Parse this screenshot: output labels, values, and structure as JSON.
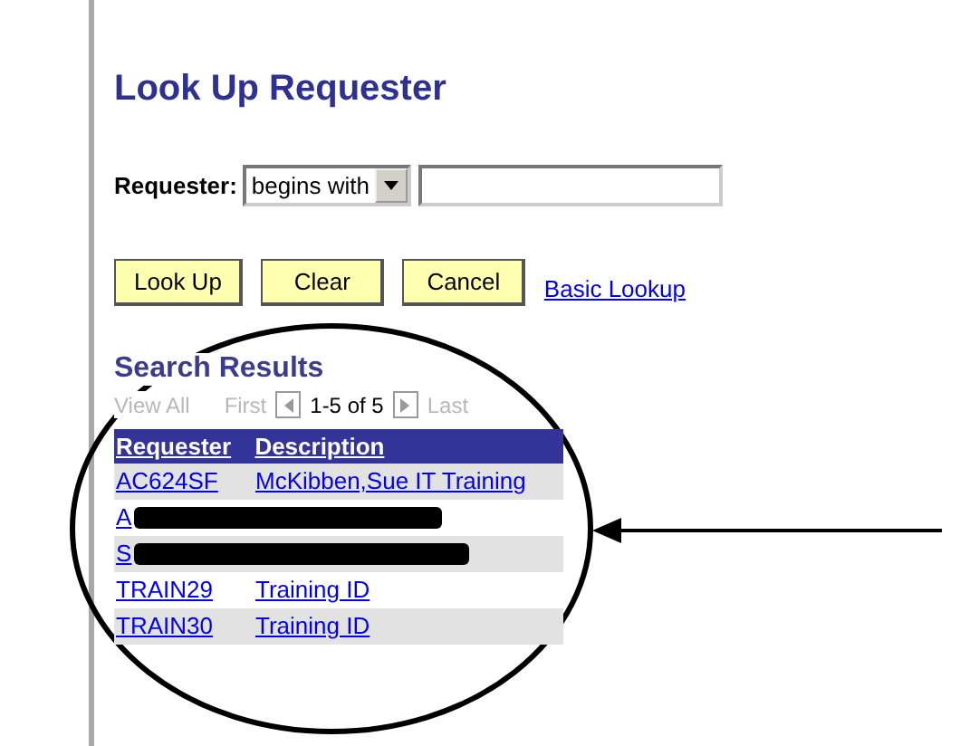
{
  "page": {
    "title": "Look Up Requester"
  },
  "search": {
    "label": "Requester:",
    "operator": "begins with"
  },
  "buttons": [
    {
      "label": "Look Up",
      "kind": "button"
    },
    {
      "label": "Clear",
      "kind": "button"
    },
    {
      "label": "Cancel",
      "kind": "button"
    },
    {
      "label": "Basic Lookup",
      "kind": "link"
    }
  ],
  "results": {
    "title": "Search Results",
    "nav": {
      "view_all": "View All",
      "first": "First",
      "range": "1-5 of 5",
      "last": "Last",
      "disabled": true
    },
    "columns": [
      "Requester",
      "Description"
    ],
    "rows": [
      {
        "requester": "AC624SF",
        "description": "McKibben,Sue IT Training",
        "redacted": false
      },
      {
        "requester": "A",
        "redacted": true
      },
      {
        "requester": "S",
        "redacted": true
      },
      {
        "requester": "TRAIN29",
        "description": "Training ID",
        "redacted": false
      },
      {
        "requester": "TRAIN30",
        "description": "Training ID",
        "redacted": false
      }
    ]
  }
}
